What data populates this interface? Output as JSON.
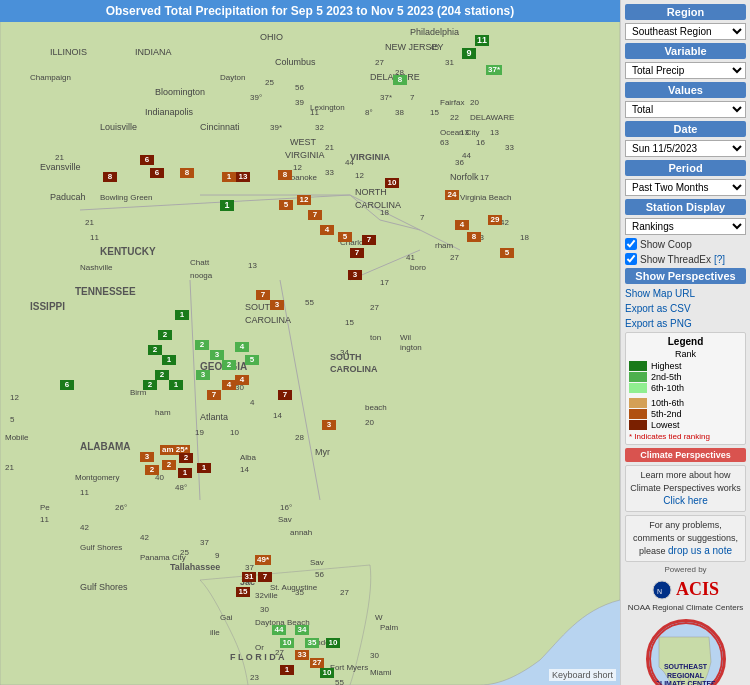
{
  "header": {
    "title": "Observed Total Precipitation for Sep 5 2023 to Nov 5 2023 (204 stations)"
  },
  "sidebar": {
    "region_label": "Region",
    "region_value": "Southeast Region",
    "variable_label": "Variable",
    "variable_value": "Total Precip",
    "values_label": "Values",
    "values_value": "Total",
    "date_label": "Date",
    "date_value": "Sun 11/5/2023",
    "period_label": "Period",
    "period_value": "Past Two Months",
    "station_display_label": "Station Display",
    "station_display_value": "Rankings",
    "show_coop_label": "Show Coop",
    "show_threadex_label": "Show ThreadEx",
    "threadex_link": "[?]",
    "show_perspectives_label": "Show Perspectives",
    "show_map_url": "Show Map URL",
    "export_csv": "Export as CSV",
    "export_png": "Export as PNG",
    "legend_title": "Legend",
    "legend_rank_label": "Rank",
    "legend_highest": "Highest",
    "legend_2to5": "2nd-5th",
    "legend_6to10": "6th-10th",
    "legend_10to6": "10th-6th",
    "legend_5to2": "5th-2nd",
    "legend_lowest": "Lowest",
    "legend_tied": "* Indicates tied ranking",
    "climate_persp_label": "Climate Perspectives",
    "climate_learn": "Learn more about how Climate Perspectives works",
    "climate_click": "Click here",
    "problems_text": "For any problems, comments or suggestions, please",
    "drop_note": "drop us a note",
    "powered_by": "Powered by",
    "lacis": "ACIS",
    "noaa_text": "NOAA Regional Climate Centers",
    "srcc_line1": "SOUTHEAST REGIONAL",
    "srcc_line2": "CLIMATE CENTER"
  },
  "keyboard_shortcut": "Keyboard short",
  "legend_colors": {
    "highest": "#1a7a1a",
    "2to5": "#4db04d",
    "6to10": "#90ee90",
    "10to6": "#d4a056",
    "5to2": "#b05010",
    "lowest": "#7a2000"
  }
}
